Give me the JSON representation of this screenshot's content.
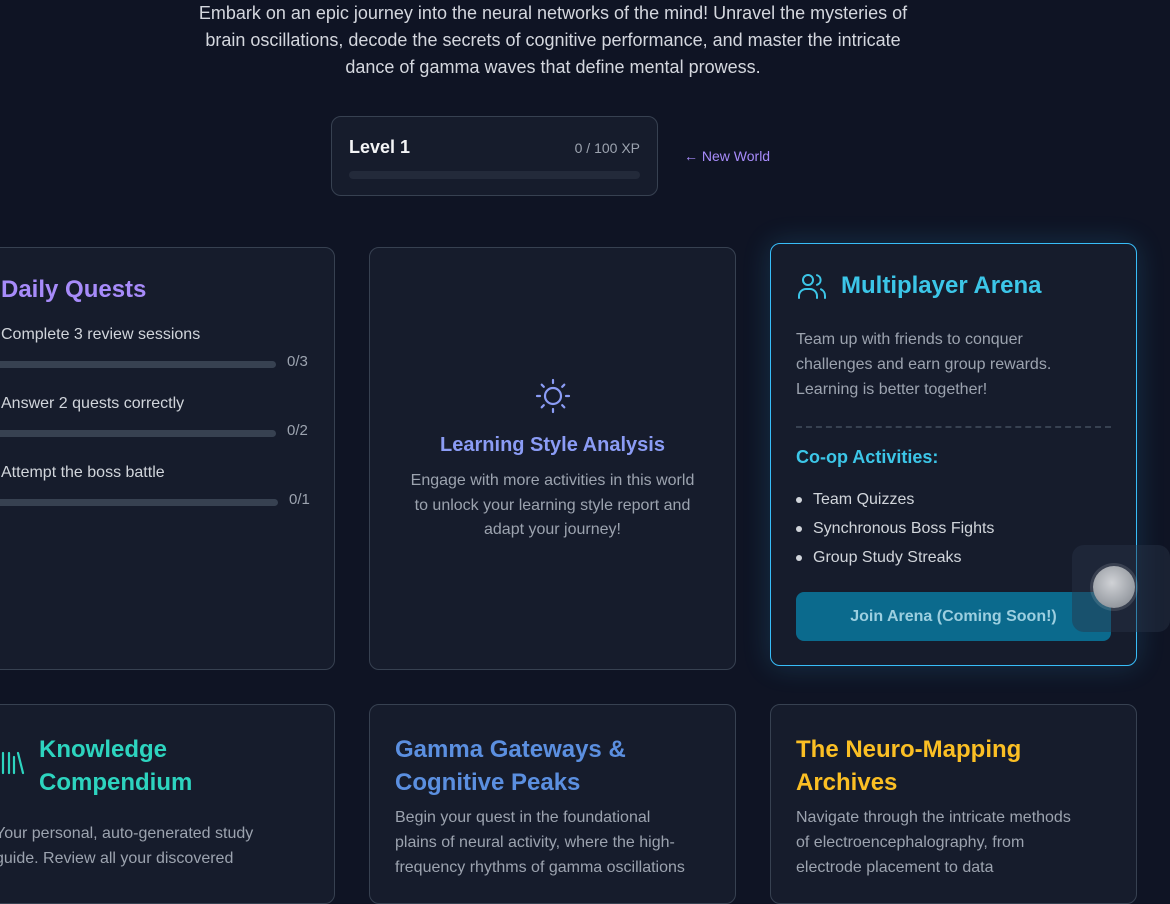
{
  "intro": {
    "lines": [
      "Embark on an epic journey into the neural networks of the mind! Unravel the mysteries of",
      "brain oscillations, decode the secrets of cognitive performance, and master the intricate",
      "dance of gamma waves that define mental prowess."
    ]
  },
  "level": {
    "title": "Level 1",
    "xp": "0 / 100 XP",
    "progress": 0.0
  },
  "nav": {
    "new_world": "← New World"
  },
  "daily_quests": {
    "title": "Daily Quests",
    "quests": [
      {
        "label": "Complete 3 review sessions",
        "count": "0/3",
        "progress": 0.0
      },
      {
        "label": "Answer 2 quests correctly",
        "count": "0/2",
        "progress": 0.0
      },
      {
        "label": "Attempt the boss battle",
        "count": "0/1",
        "progress": 0.0
      }
    ]
  },
  "learning_style": {
    "icon": "sun-icon",
    "title": "Learning Style Analysis",
    "text_lines": [
      "Engage with more activities in this world",
      "to unlock your learning style report and",
      "adapt your journey!"
    ]
  },
  "arena": {
    "icon": "users-icon",
    "title": "Multiplayer Arena",
    "text_lines": [
      "Team up with friends to conquer",
      "challenges and earn group rewards.",
      "Learning is better together!"
    ],
    "subhead": "Co-op Activities:",
    "activities": [
      "Team Quizzes",
      "Synchronous Boss Fights",
      "Group Study Streaks"
    ],
    "button": "Join Arena (Coming Soon!)"
  },
  "compendium": {
    "icon": "library-icon",
    "title_lines": [
      "Knowledge",
      "Compendium"
    ],
    "text_lines": [
      "Your personal, auto-generated study",
      "guide. Review all your discovered"
    ]
  },
  "gamma": {
    "title_lines": [
      "Gamma Gateways &",
      "Cognitive Peaks"
    ],
    "text_lines": [
      "Begin your quest in the foundational",
      "plains of neural activity, where the high-",
      "frequency rhythms of gamma oscillations"
    ]
  },
  "neuro": {
    "title_lines": [
      "The Neuro-Mapping",
      "Archives"
    ],
    "text_lines": [
      "Navigate through the intricate methods",
      "of electroencephalography, from",
      "electrode placement to data"
    ]
  },
  "colors": {
    "background": "#0f1424",
    "purple_accent": "#a78bfa",
    "cyan_accent": "#3cc6e8",
    "teal_accent": "#2dd4bf",
    "blue_accent": "#5b8fe0",
    "gold_accent": "#fbbf24"
  }
}
